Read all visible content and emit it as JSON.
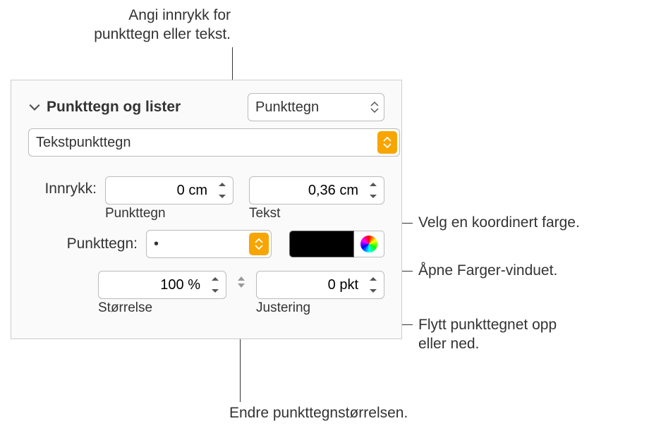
{
  "callouts": {
    "top": "Angi innrykk for\npunkttegn eller tekst.",
    "color_swatch": "Velg en koordinert farge.",
    "color_wheel": "Åpne Farger-vinduet.",
    "alignment": "Flytt punkttegnet opp\neller ned.",
    "size": "Endre punkttegnstørrelsen."
  },
  "panel": {
    "header_label": "Punkttegn og lister",
    "style_select": "Punkttegn",
    "text_bullets_select": "Tekstpunkttegn",
    "indent": {
      "label": "Innrykk:",
      "bullet_value": "0 cm",
      "bullet_sub": "Punkttegn",
      "text_value": "0,36 cm",
      "text_sub": "Tekst"
    },
    "bullet_row": {
      "label": "Punkttegn:",
      "char": "•"
    },
    "size": {
      "value": "100 %",
      "sub": "Størrelse"
    },
    "alignment": {
      "value": "0 pkt",
      "sub": "Justering"
    }
  }
}
